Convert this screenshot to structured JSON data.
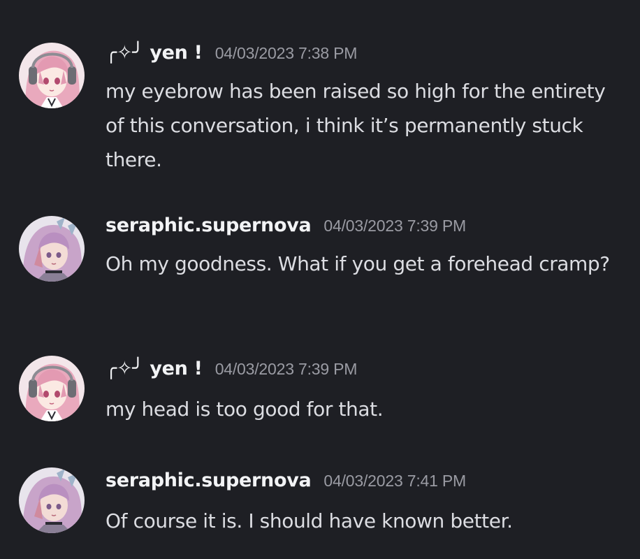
{
  "messages": [
    {
      "author": "╭✧╯ yen !",
      "timestamp": "04/03/2023 7:38 PM",
      "text": "my eyebrow has been raised so high for the entirety of this conversation, i think it’s permanently stuck there.",
      "avatar": "pink-hair-headphones-avatar"
    },
    {
      "author": "seraphic.supernova",
      "timestamp": "04/03/2023 7:39 PM",
      "text": "Oh my goodness. What if you get a forehead cramp?",
      "avatar": "lavender-hair-avatar"
    },
    {
      "author": "╭✧╯ yen !",
      "timestamp": "04/03/2023 7:39 PM",
      "text": "my head is too good for that.",
      "avatar": "pink-hair-headphones-avatar"
    },
    {
      "author": "seraphic.supernova",
      "timestamp": "04/03/2023 7:41 PM",
      "text": "Of course it is. I should have known better.",
      "avatar": "lavender-hair-avatar"
    }
  ],
  "colors": {
    "background": "#1e1f24",
    "username": "#f2f3f5",
    "timestamp": "#9a9ba3",
    "message_text": "#dcdde2"
  }
}
